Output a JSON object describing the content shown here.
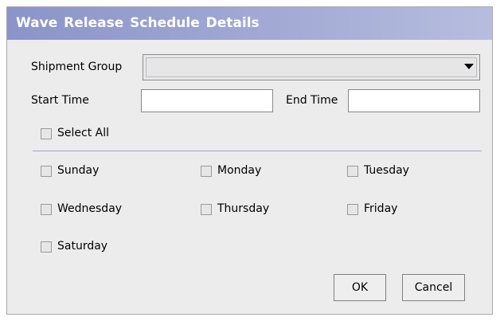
{
  "dialog": {
    "title": "Wave Release Schedule Details"
  },
  "form": {
    "shipment_group_label": "Shipment Group",
    "shipment_group_value": "",
    "start_time_label": "Start Time",
    "start_time_value": "",
    "end_time_label": "End Time",
    "end_time_value": "",
    "select_all_label": "Select All",
    "select_all_checked": false
  },
  "days": [
    {
      "label": "Sunday",
      "checked": false
    },
    {
      "label": "Monday",
      "checked": false
    },
    {
      "label": "Tuesday",
      "checked": false
    },
    {
      "label": "Wednesday",
      "checked": false
    },
    {
      "label": "Thursday",
      "checked": false
    },
    {
      "label": "Friday",
      "checked": false
    },
    {
      "label": "Saturday",
      "checked": false
    }
  ],
  "buttons": {
    "ok_label": "OK",
    "cancel_label": "Cancel"
  },
  "colors": {
    "title_gradient_start": "#8b94c9",
    "title_gradient_end": "#b6bddf",
    "dialog_background": "#ececec",
    "separator": "#9da5cf"
  },
  "icons": {
    "dropdown": "chevron-down-icon"
  }
}
